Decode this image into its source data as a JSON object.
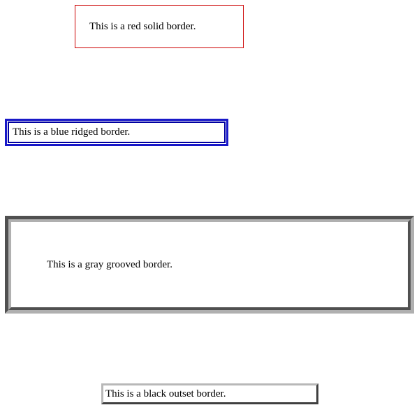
{
  "boxes": {
    "red_solid": {
      "text": "This is a red solid border.",
      "border_color": "#cc0000",
      "border_style": "solid"
    },
    "blue_ridged": {
      "text": "This is a blue ridged border.",
      "border_color": "#1818c8",
      "border_style": "ridge"
    },
    "gray_grooved": {
      "text": "This is a gray grooved border.",
      "border_color": "#808080",
      "border_style": "groove"
    },
    "black_outset": {
      "text": "This is a black outset border.",
      "border_color": "#000000",
      "border_style": "outset"
    }
  }
}
